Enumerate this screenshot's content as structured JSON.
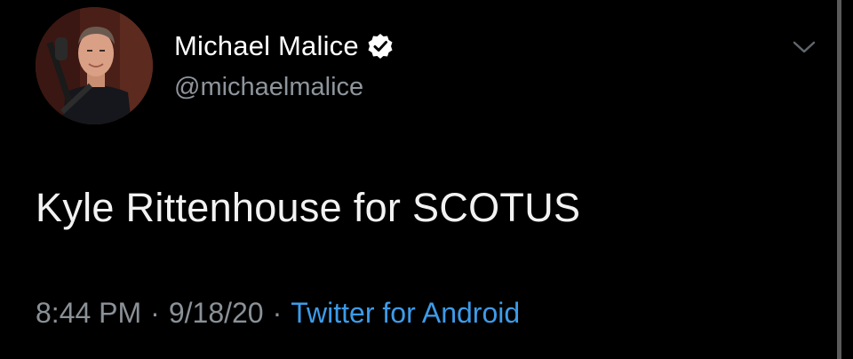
{
  "author": {
    "display_name": "Michael Malice",
    "handle": "@michaelmalice",
    "verified_icon": "verified-badge-icon",
    "avatar_icon": "profile-photo"
  },
  "tweet": {
    "text": "Kyle Rittenhouse for SCOTUS"
  },
  "meta": {
    "time": "8:44 PM",
    "separator": "·",
    "date": "9/18/20",
    "source": "Twitter for Android"
  },
  "menu": {
    "icon": "chevron-down-icon"
  },
  "colors": {
    "background": "#000000",
    "name": "#ffffff",
    "handle": "#8e959c",
    "link": "#3d9be9"
  }
}
